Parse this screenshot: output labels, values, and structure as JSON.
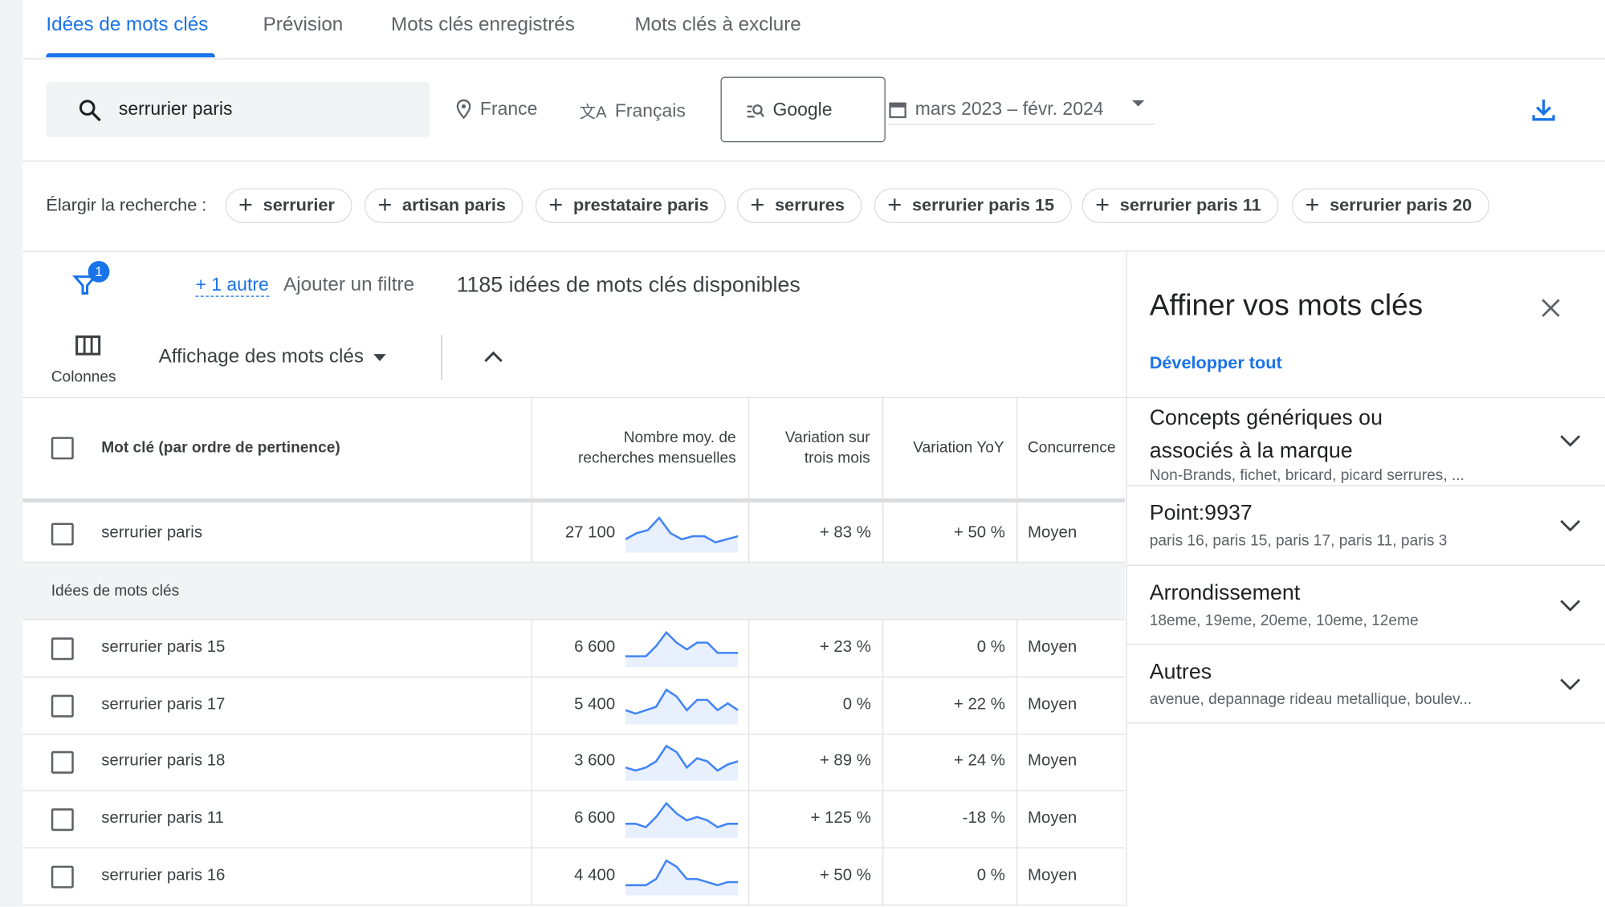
{
  "tabs": [
    "Idées de mots clés",
    "Prévision",
    "Mots clés enregistrés",
    "Mots clés à exclure"
  ],
  "search": {
    "value": "serrurier paris",
    "location": "France",
    "language": "Français",
    "network": "Google",
    "date_range": "mars 2023 – févr. 2024"
  },
  "broaden": {
    "label": "Élargir la recherche :",
    "chips": [
      "serrurier",
      "artisan paris",
      "prestataire paris",
      "serrures",
      "serrurier paris 15",
      "serrurier paris 11",
      "serrurier paris 20"
    ]
  },
  "filters": {
    "badge": "1",
    "more": "+ 1 autre",
    "add": "Ajouter un filtre",
    "count": "1185 idées de mots clés disponibles"
  },
  "toolbar": {
    "columns": "Colonnes",
    "view": "Affichage des mots clés"
  },
  "table": {
    "headers": {
      "keyword": "Mot clé (par ordre de pertinence)",
      "avg1": "Nombre moy. de",
      "avg2": "recherches mensuelles",
      "three1": "Variation sur",
      "three2": "trois mois",
      "yoy": "Variation YoY",
      "comp": "Concurrence"
    },
    "main_row": {
      "keyword": "serrurier paris",
      "avg": "27 100",
      "three": "+ 83 %",
      "yoy": "+ 50 %",
      "comp": "Moyen",
      "trend": [
        3,
        5,
        6,
        10,
        5,
        3,
        4,
        4,
        2,
        3,
        4
      ]
    },
    "group_label": "Idées de mots clés",
    "rows": [
      {
        "keyword": "serrurier paris 15",
        "avg": "6 600",
        "three": "+ 23 %",
        "yoy": "0 %",
        "comp": "Moyen",
        "trend": [
          2,
          2,
          2,
          5,
          9,
          6,
          4,
          6,
          6,
          3,
          3,
          3
        ]
      },
      {
        "keyword": "serrurier paris 17",
        "avg": "5 400",
        "three": "0 %",
        "yoy": "+ 22 %",
        "comp": "Moyen",
        "trend": [
          3,
          2,
          3,
          4,
          9,
          7,
          3,
          6,
          6,
          3,
          5,
          3
        ]
      },
      {
        "keyword": "serrurier paris 18",
        "avg": "3 600",
        "three": "+ 89 %",
        "yoy": "+ 24 %",
        "comp": "Moyen",
        "trend": [
          3,
          2,
          3,
          5,
          10,
          8,
          3,
          6,
          5,
          2,
          4,
          5
        ]
      },
      {
        "keyword": "serrurier paris 11",
        "avg": "6 600",
        "three": "+ 125 %",
        "yoy": "-18 %",
        "comp": "Moyen",
        "trend": [
          3,
          3,
          2,
          5,
          9,
          6,
          4,
          5,
          4,
          2,
          3,
          3
        ]
      },
      {
        "keyword": "serrurier paris 16",
        "avg": "4 400",
        "three": "+ 50 %",
        "yoy": "0 %",
        "comp": "Moyen",
        "trend": [
          2,
          2,
          2,
          4,
          10,
          8,
          4,
          4,
          3,
          2,
          3,
          3
        ]
      }
    ]
  },
  "panel": {
    "title": "Affiner vos mots clés",
    "expand": "Développer tout",
    "sections": [
      {
        "t1": "Concepts génériques ou",
        "t2": "associés à la marque",
        "sub": "Non-Brands, fichet, bricard, picard serrures, ..."
      },
      {
        "t1": "Point:9937",
        "sub": "paris 16, paris 15, paris 17, paris 11, paris 3"
      },
      {
        "t1": "Arrondissement",
        "sub": "18eme, 19eme, 20eme, 10eme, 12eme"
      },
      {
        "t1": "Autres",
        "sub": "avenue, depannage rideau metallique, boulev..."
      }
    ]
  },
  "colors": {
    "accent": "#1a73e8",
    "spark_line": "#4285f4",
    "spark_fill": "#e8f0fe"
  }
}
